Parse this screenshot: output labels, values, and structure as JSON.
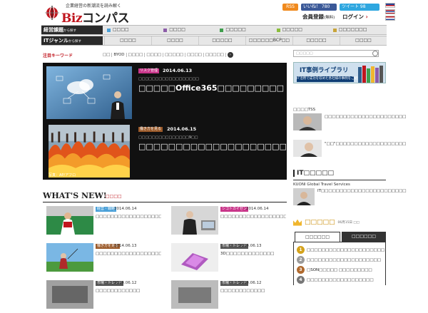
{
  "header": {
    "tagline": "企業経営の新潮流を読み解く",
    "logo_main": "Biz",
    "logo_sub": "コンパス",
    "rss": "RSS",
    "like": "いいね！ 780",
    "tweet": "ツイート 98",
    "member_label": "会員登録",
    "member_note": "(無料)",
    "login_label": "ログイン"
  },
  "nav": {
    "row1_label": "経営課題",
    "row1_suffix": "から探す",
    "row2_label": "ITジャンル",
    "row2_suffix": "から探す",
    "row1_items": [
      {
        "label": "□□□□",
        "color": "#4aa0d8"
      },
      {
        "label": "□□□□",
        "color": "#8c5ca8"
      },
      {
        "label": "□□□□□",
        "color": "#3f9e4d"
      },
      {
        "label": "□□□□□",
        "color": "#8bbd3c"
      },
      {
        "label": "□□□□□□□",
        "color": "#c8a43a"
      }
    ],
    "row2_items": [
      "□□□□",
      "□□□□",
      "□□□□□",
      "□□□□□□BCP□□",
      "□□□□□",
      "□□□□"
    ]
  },
  "keywords": {
    "label": "注目キーワード",
    "tags": [
      "□□",
      "BYOD",
      "□□□□",
      "□□□□",
      "□□□□□",
      "□□□□",
      "□□□□□"
    ]
  },
  "feature": [
    {
      "badge": "リスク管理",
      "badge_color": "#c9368a",
      "date": "2014.06.13",
      "subtitle": "□□□□□□□□□□□□□□□□□□",
      "title": "□□□□□Office365□□□□□□□□□"
    },
    {
      "badge": "働き方を見る",
      "badge_color": "#9b5a2a",
      "date": "2014.06.15",
      "subtitle": "□□□□□□□□□□□□□□□9□□",
      "title": "□□□□□□□□□□□□□□□□□□□□□□□",
      "caption": "写真：AP/アフロ"
    }
  ],
  "whatsnew": {
    "title": "WHAT'S NEW!",
    "sub": "□□□□",
    "items": [
      {
        "badge": "経営・戦略",
        "badge_color": "#4aa0d8",
        "date": "2014.06.14",
        "title": "□□□□□□□□□□□□□□□□□□□5□□□□□"
      },
      {
        "badge": "シゴトカイゼン",
        "badge_color": "#c9368a",
        "date": "2014.06.14",
        "title": "□□□□□□□□□□□□□□□□□□□□□□□□□"
      },
      {
        "badge": "働き方を見る",
        "badge_color": "#9b5a2a",
        "date": "2014.06.13",
        "title": "□□□□□□□□□□□□□□□□□□□□"
      },
      {
        "badge": "市場・トレンド",
        "badge_color": "#555555",
        "date": "2014.06.13",
        "title": "3D□□□□□□□□□□□□□"
      },
      {
        "badge": "市場・トレンド",
        "badge_color": "#555555",
        "date": "2014.06.12",
        "title": "□□□□□□□□□□□□"
      },
      {
        "badge": "市場・トレンド",
        "badge_color": "#555555",
        "date": "2014.06.12",
        "title": "□□□□□□□□□□□□"
      }
    ]
  },
  "sidebar": {
    "search_placeholder": "□□□□□",
    "banner_title": "IT事例ライブラリ",
    "banner_sub": "IT活用で成功を収めた各社様の事例をご紹介",
    "entry1_head": "□□□□TSS",
    "entry1_text": "□□□□□□□□□□□□□□□□□□□□□□",
    "entry2_text": "\"□□\"□□□□□□□□□□□□□□□□□□□",
    "section_title": "IT□□□□□",
    "entry3_head": "KUONI Global Travel Services",
    "entry3_text": "IT□□□□□□□□□□□□□□□□□□□□□□□",
    "ranking_title": "□□□□□",
    "ranking_date": "06月15日 □□",
    "tab1": "□□□□□□",
    "tab2": "□□□□□□",
    "ranks": [
      {
        "n": "1",
        "color": "#d4a21c",
        "text": "□□□□□□□□□□□□□□□□□□□□□"
      },
      {
        "n": "2",
        "color": "#9a9a9a",
        "text": "□□□□□□□□□□□□□□□□□□□□"
      },
      {
        "n": "3",
        "color": "#b06a2e",
        "text": "□SON□□□□□ □□□□□□□□□"
      },
      {
        "n": "4",
        "color": "#777777",
        "text": "□□□□□□□□□□□□□□□□□□"
      }
    ]
  }
}
